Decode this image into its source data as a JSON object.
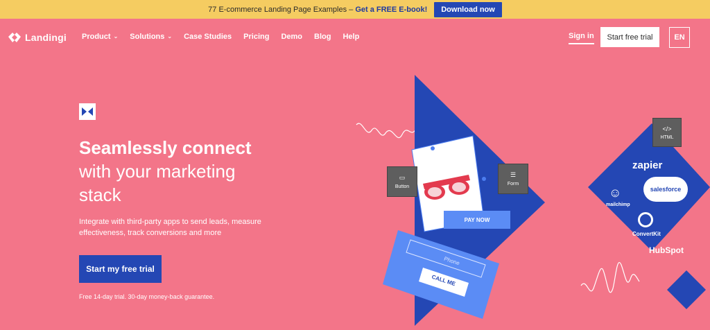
{
  "banner": {
    "text_plain": "77 E-commerce Landing Page Examples – ",
    "text_bold": "Get a FREE E-book!",
    "button": "Download now"
  },
  "nav": {
    "logo_text": "Landingi",
    "items": [
      {
        "label": "Product",
        "dropdown": true
      },
      {
        "label": "Solutions",
        "dropdown": true
      },
      {
        "label": "Case Studies",
        "dropdown": false
      },
      {
        "label": "Pricing",
        "dropdown": false
      },
      {
        "label": "Demo",
        "dropdown": false
      },
      {
        "label": "Blog",
        "dropdown": false
      },
      {
        "label": "Help",
        "dropdown": false
      }
    ],
    "signin": "Sign in",
    "trial": "Start free trial",
    "lang": "EN"
  },
  "hero": {
    "headline_bold": "Seamlessly connect",
    "headline_line2": "with your marketing",
    "headline_line3": "stack",
    "description": "Integrate with third-party apps to send leads, measure effectiveness, track conversions and more",
    "cta": "Start my free trial",
    "guarantee": "Free 14-day trial. 30-day money-back guarantee."
  },
  "illustration": {
    "chip_button": "Button",
    "chip_form": "Form",
    "chip_html": "HTML",
    "pay_now": "PAY NOW",
    "phone_placeholder": "Phone",
    "call_me": "CALL ME",
    "brands": [
      "zapier",
      "salesforce",
      "mailchimp",
      "ConvertKit",
      "HubSpot"
    ]
  },
  "colors": {
    "background": "#f37589",
    "banner": "#f5cc61",
    "primary": "#2447b4",
    "accent": "#5b8cf5"
  }
}
